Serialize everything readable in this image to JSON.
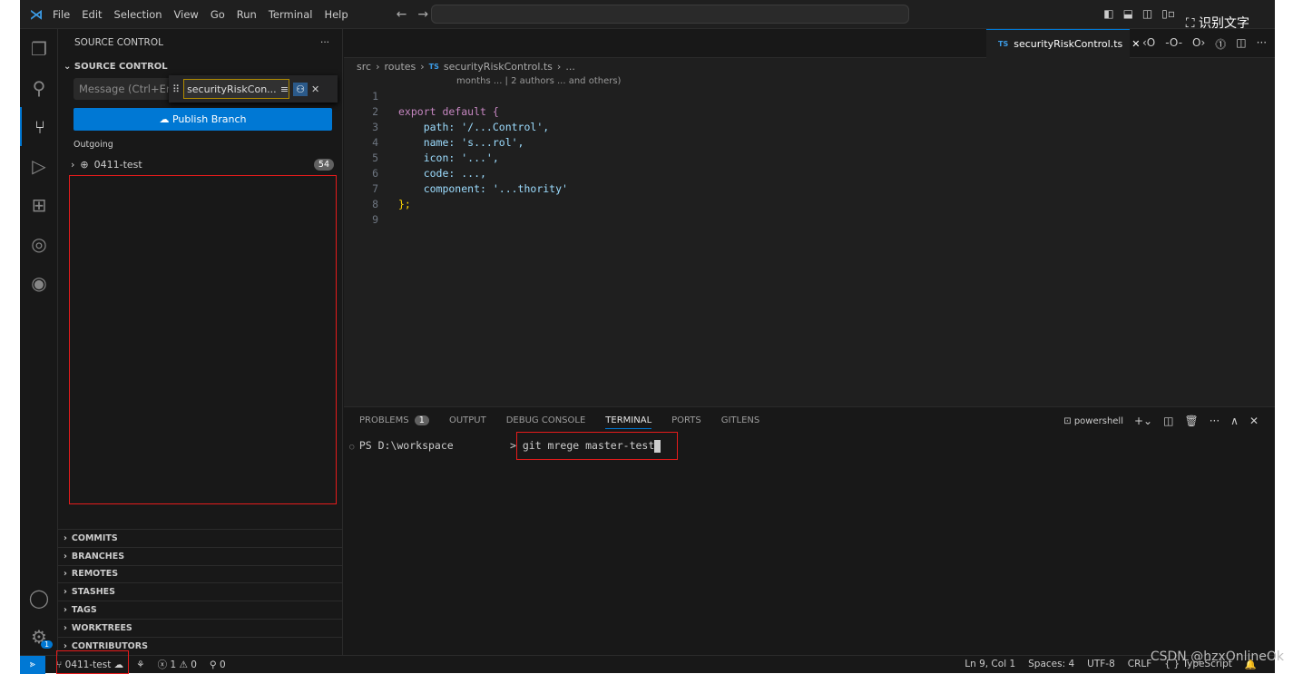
{
  "titlebar": {
    "menu": [
      "File",
      "Edit",
      "Selection",
      "View",
      "Go",
      "Run",
      "Terminal",
      "Help"
    ],
    "ocr_button": "识别文字"
  },
  "sidebar": {
    "title": "SOURCE CONTROL",
    "section": "SOURCE CONTROL",
    "message_placeholder": "Message (Ctrl+Enter",
    "find_value": "securityRiskCon...",
    "publish_label": "Publish Branch",
    "outgoing_label": "Outgoing",
    "branch": "0411-test",
    "branch_count": "54",
    "sections": [
      "COMMITS",
      "BRANCHES",
      "REMOTES",
      "STASHES",
      "TAGS",
      "WORKTREES",
      "CONTRIBUTORS"
    ]
  },
  "editor": {
    "tab": "securityRiskControl.ts",
    "tab_lang": "TS",
    "breadcrumb": [
      "src",
      "routes",
      "securityRiskControl.ts",
      "..."
    ],
    "codelens": "months ... | 2 authors ... and others)",
    "lines": [
      {
        "n": "1",
        "t": ""
      },
      {
        "n": "2",
        "t": "export default {"
      },
      {
        "n": "3",
        "t": "    path: '/...Control',"
      },
      {
        "n": "4",
        "t": "    name: 's...rol',"
      },
      {
        "n": "5",
        "t": "    icon: '...',"
      },
      {
        "n": "6",
        "t": "    code: ...,"
      },
      {
        "n": "7",
        "t": "    component: '...thority'"
      },
      {
        "n": "8",
        "t": "};"
      },
      {
        "n": "9",
        "t": ""
      }
    ]
  },
  "panel": {
    "tabs": [
      "PROBLEMS",
      "OUTPUT",
      "DEBUG CONSOLE",
      "TERMINAL",
      "PORTS",
      "GITLENS"
    ],
    "problems_count": "1",
    "active": "TERMINAL",
    "shell": "powershell",
    "prompt": "PS D:\\workspace",
    "command": "> git mrege master-test"
  },
  "status": {
    "branch": "0411-test",
    "errors": "1",
    "warnings": "0",
    "ports": "0",
    "position": "Ln 9, Col 1",
    "spaces": "Spaces: 4",
    "encoding": "UTF-8",
    "eol": "CRLF",
    "language": "TypeScript",
    "watermark": "CSDN @hzxOnlineOk",
    "accounts_badge": "1"
  },
  "colors": {
    "accent": "#0078d4",
    "highlight": "#e51b1b"
  }
}
